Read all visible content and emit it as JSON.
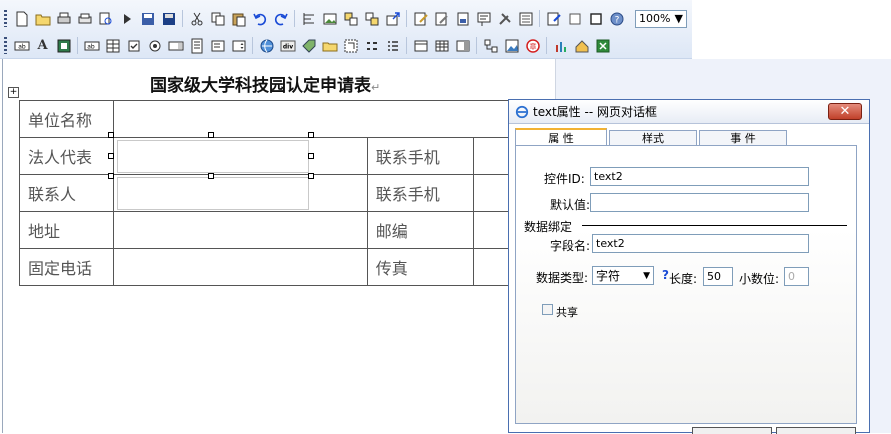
{
  "toolbar": {
    "zoom": "100%",
    "row1_icons": [
      "new-file-icon",
      "open-folder-icon",
      "print-icon",
      "print-preview-icon",
      "search-icon",
      "play-icon",
      "save-icon",
      "save-all-icon",
      "cut-icon",
      "copy-icon",
      "paste-icon",
      "undo-icon",
      "redo-icon",
      "align-left-icon",
      "image-icon",
      "move-icon",
      "copy-object-icon",
      "send-icon",
      "edit-icon",
      "edit-page-icon",
      "page-icon",
      "form-icon",
      "tools-icon",
      "document-icon",
      "pen-doc-icon",
      "checkbox-empty-icon",
      "frame-icon",
      "help-icon"
    ],
    "row2_icons": [
      "textbox-icon",
      "font-icon",
      "image-field-icon",
      "combo-field-icon",
      "grid-field-icon",
      "checkbox-icon",
      "radio-icon",
      "listbox-icon",
      "tree-icon",
      "select-field-icon",
      "spinner-icon",
      "globe-icon",
      "div-icon",
      "tag-icon",
      "folder-icon",
      "frame-select-icon",
      "option-list-icon",
      "dotted-list-icon",
      "table-icon",
      "grid-table-icon",
      "split-table-icon",
      "connector-icon",
      "picture-icon",
      "stamp-icon",
      "chart-icon",
      "home-icon",
      "excel-icon"
    ]
  },
  "document": {
    "title": "国家级大学科技园认定申请表",
    "paragraph_mark": "↵",
    "anchor_glyph": "+",
    "rows": [
      {
        "label": "单位名称"
      },
      {
        "label": "法人代表",
        "label2": "联系手机"
      },
      {
        "label": "联系人",
        "label2": "联系手机"
      },
      {
        "label": "地址",
        "label2": "邮编"
      },
      {
        "label": "固定电话",
        "label2": "传真"
      }
    ]
  },
  "dialog": {
    "title": "text属性 -- 网页对话框",
    "close_glyph": "✕",
    "tabs": [
      {
        "label": "属 性",
        "active": true
      },
      {
        "label": "样式",
        "active": false
      },
      {
        "label": "事 件",
        "active": false
      }
    ],
    "control_id_label": "控件ID:",
    "control_id_value": "text2",
    "default_label": "默认值:",
    "default_value": "",
    "data_binding_label": "数据绑定",
    "field_name_label": "字段名:",
    "field_name_value": "text2",
    "data_type_label": "数据类型:",
    "data_type_value": "字符",
    "help_mark": "?",
    "length_label": "长度:",
    "length_value": "50",
    "decimals_label": "小数位:",
    "decimals_value": "0",
    "share_label": "共享",
    "share_checked": false
  }
}
